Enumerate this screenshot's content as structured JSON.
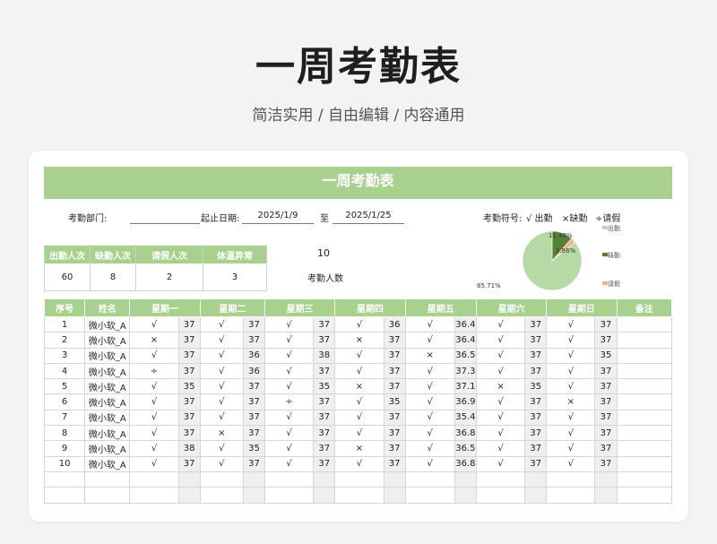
{
  "page": {
    "title": "一周考勤表",
    "subtitle": "简洁实用 / 自由编辑 / 内容通用"
  },
  "sheet": {
    "title": "一周考勤表",
    "dept_label": "考勤部门:",
    "date_label": "起止日期:",
    "start_date": "2025/1/9",
    "to_label": "至",
    "end_date": "2025/1/25",
    "symbol_label": "考勤符号:",
    "symbols": [
      "√ 出勤",
      "×缺勤",
      "÷请假"
    ]
  },
  "stats": {
    "headers": [
      "出勤人次",
      "缺勤人次",
      "请假人次",
      "体温异常"
    ],
    "values": [
      "60",
      "8",
      "2",
      "3"
    ],
    "count_value": "10",
    "count_label": "考勤人数"
  },
  "colors": {
    "accent": "#a9d18e",
    "present": "#b7d9a5",
    "absent": "#548235",
    "leave": "#f4b183"
  },
  "chart_data": {
    "type": "pie",
    "labels": [
      "出勤",
      "缺勤",
      "请假"
    ],
    "values": [
      85.71,
      11.43,
      2.86
    ],
    "value_labels": [
      "85.71%",
      "11.43%",
      "2.86%"
    ],
    "legend": "right"
  },
  "table": {
    "headers": [
      "序号",
      "姓名",
      "星期一",
      "星期二",
      "星期三",
      "星期四",
      "星期五",
      "星期六",
      "星期日",
      "备注"
    ],
    "rows": [
      [
        "1",
        "微小软_A",
        "√",
        "37",
        "√",
        "37",
        "√",
        "37",
        "√",
        "36",
        "√",
        "36.4",
        "√",
        "37",
        "√",
        "37",
        ""
      ],
      [
        "2",
        "微小软_A",
        "×",
        "37",
        "√",
        "37",
        "√",
        "37",
        "×",
        "37",
        "√",
        "36.4",
        "√",
        "37",
        "√",
        "37",
        ""
      ],
      [
        "3",
        "微小软_A",
        "√",
        "37",
        "√",
        "36",
        "√",
        "38",
        "√",
        "37",
        "×",
        "36.5",
        "√",
        "37",
        "√",
        "35",
        ""
      ],
      [
        "4",
        "微小软_A",
        "÷",
        "37",
        "√",
        "36",
        "√",
        "37",
        "√",
        "37",
        "√",
        "37.3",
        "√",
        "37",
        "√",
        "37",
        ""
      ],
      [
        "5",
        "微小软_A",
        "√",
        "35",
        "√",
        "37",
        "√",
        "35",
        "×",
        "37",
        "√",
        "37.1",
        "×",
        "35",
        "√",
        "37",
        ""
      ],
      [
        "6",
        "微小软_A",
        "√",
        "37",
        "√",
        "37",
        "÷",
        "37",
        "√",
        "35",
        "√",
        "36.9",
        "√",
        "37",
        "×",
        "37",
        ""
      ],
      [
        "7",
        "微小软_A",
        "√",
        "37",
        "√",
        "37",
        "√",
        "37",
        "√",
        "37",
        "√",
        "35.4",
        "√",
        "37",
        "√",
        "37",
        ""
      ],
      [
        "8",
        "微小软_A",
        "√",
        "37",
        "×",
        "37",
        "√",
        "37",
        "√",
        "37",
        "√",
        "36.8",
        "√",
        "37",
        "√",
        "37",
        ""
      ],
      [
        "9",
        "微小软_A",
        "√",
        "38",
        "√",
        "35",
        "√",
        "37",
        "×",
        "37",
        "√",
        "36.5",
        "√",
        "37",
        "√",
        "37",
        ""
      ],
      [
        "10",
        "微小软_A",
        "√",
        "37",
        "√",
        "37",
        "√",
        "37",
        "√",
        "37",
        "√",
        "36.8",
        "√",
        "37",
        "√",
        "37",
        ""
      ]
    ],
    "highlight": [
      [
        2,
        6
      ],
      [
        3,
        10
      ],
      [
        8,
        2
      ]
    ],
    "empty_rows": 2
  }
}
